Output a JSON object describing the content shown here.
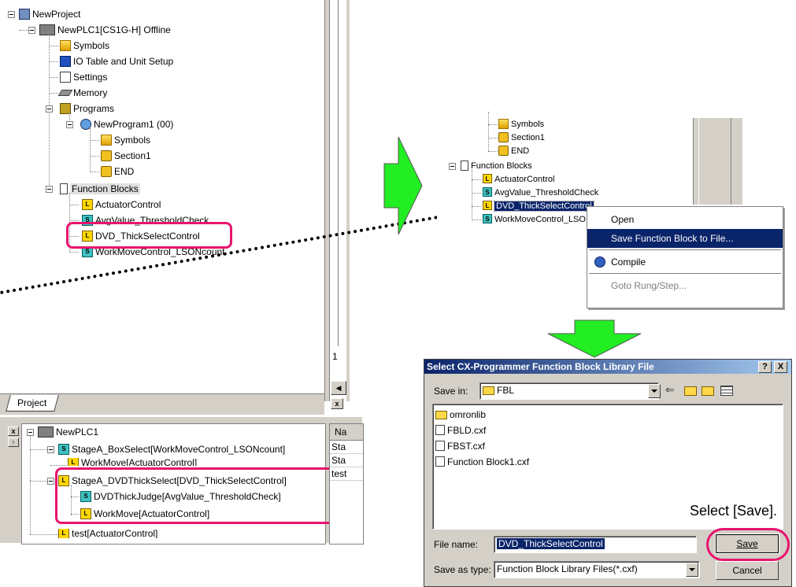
{
  "left_tree": {
    "root": "NewProject",
    "plc": "NewPLC1[CS1G-H] Offline",
    "symbols": "Symbols",
    "io_table": "IO Table and Unit Setup",
    "settings": "Settings",
    "memory": "Memory",
    "programs": "Programs",
    "program1": "NewProgram1 (00)",
    "prog_symbols": "Symbols",
    "section1": "Section1",
    "end": "END",
    "function_blocks": "Function Blocks",
    "fb_items": [
      "ActuatorControl",
      "AvgValue_ThresholdCheck",
      "DVD_ThickSelectControl",
      "WorkMoveControl_LSONcount"
    ],
    "project_tab": "Project",
    "ruler_number": "1"
  },
  "instance_tree": {
    "root": "NewPLC1",
    "items": [
      "StageA_BoxSelect[WorkMoveControl_LSONcount]",
      "WorkMove[ActuatorControl]",
      "StageA_DVDThickSelect[DVD_ThickSelectControl]",
      "DVDThickJudge[AvgValue_ThresholdCheck]",
      "WorkMove[ActuatorControl]",
      "test[ActuatorControl]"
    ],
    "name_header": "Na",
    "name_cells": [
      "Sta",
      "Sta",
      "test"
    ]
  },
  "middle_tree": {
    "symbols": "Symbols",
    "section1": "Section1",
    "end": "END",
    "function_blocks": "Function Blocks",
    "fb_items": [
      "ActuatorControl",
      "AvgValue_ThresholdCheck",
      "DVD_ThickSelectControl",
      "WorkMoveControl_LSO"
    ]
  },
  "context_menu": {
    "items": [
      "Open",
      "Save Function Block to File...",
      "Compile",
      "Goto Rung/Step..."
    ]
  },
  "dialog": {
    "title": "Select CX-Programmer Function Block Library File",
    "help_btn": "?",
    "close_btn": "X",
    "save_in_label": "Save in:",
    "save_in_value": "FBL",
    "files": [
      "omronlib",
      "FBLD.cxf",
      "FBST.cxf",
      "Function Block1.cxf"
    ],
    "file_name_label": "File name:",
    "file_name_value": "DVD_ThickSelectControl",
    "save_as_type_label": "Save as type:",
    "save_as_type_value": "Function Block Library Files(*.cxf)",
    "save_btn": "Save",
    "cancel_btn": "Cancel"
  },
  "annotation": "Select [Save].",
  "colors": {
    "highlight": "#e8146e",
    "arrow_green": "#22ee22",
    "selection": "#0a246a"
  }
}
